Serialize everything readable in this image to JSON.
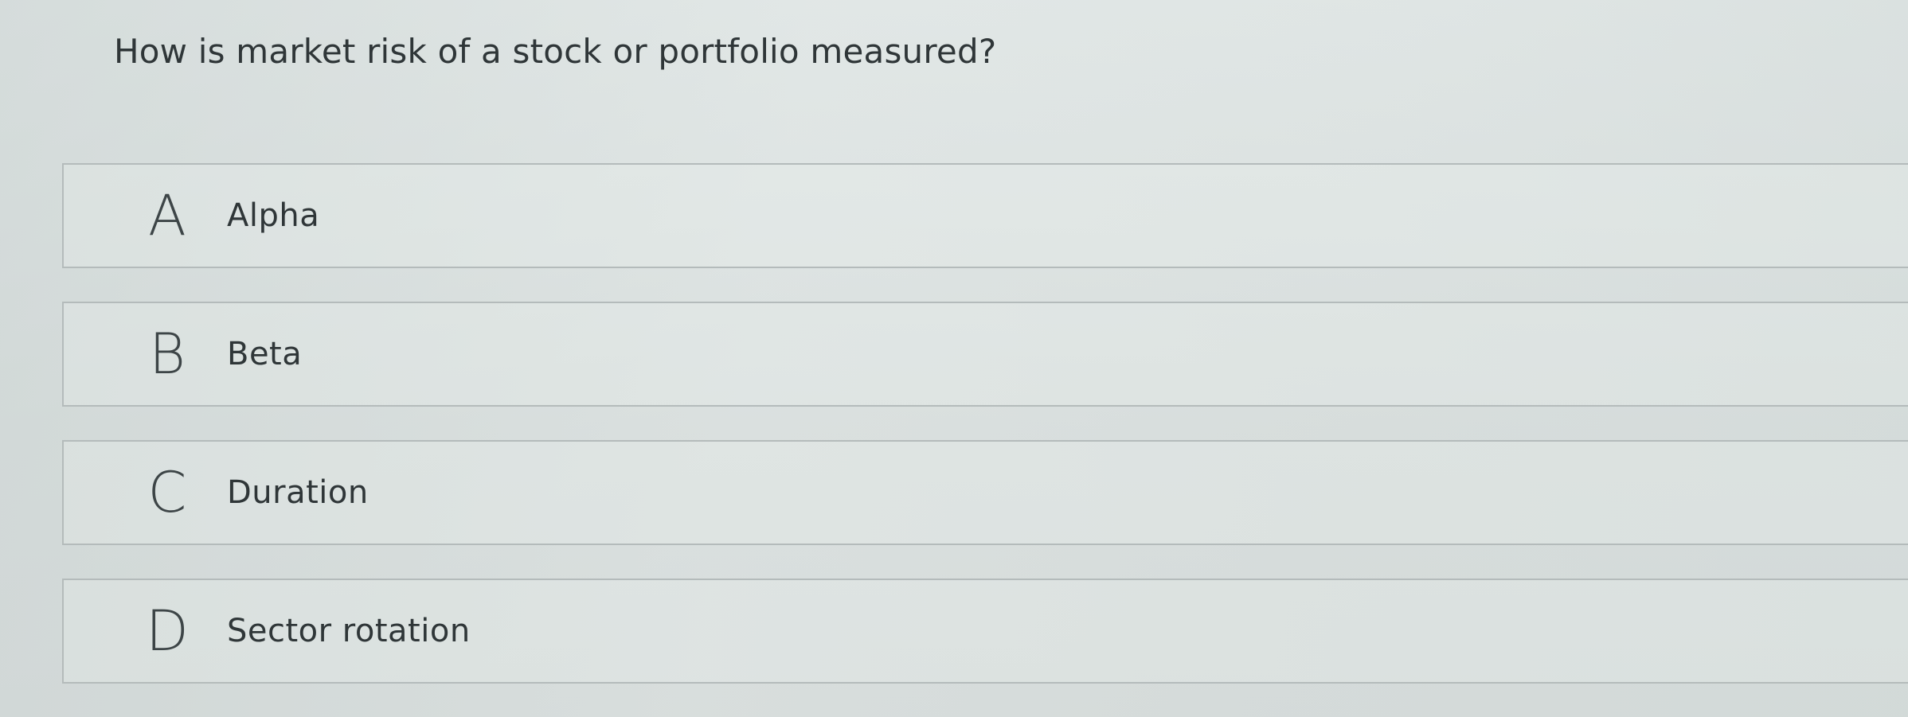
{
  "question": "How is market risk of a stock or portfolio measured?",
  "options": [
    {
      "letter": "A",
      "text": "Alpha"
    },
    {
      "letter": "B",
      "text": "Beta"
    },
    {
      "letter": "C",
      "text": "Duration"
    },
    {
      "letter": "D",
      "text": "Sector rotation"
    }
  ]
}
